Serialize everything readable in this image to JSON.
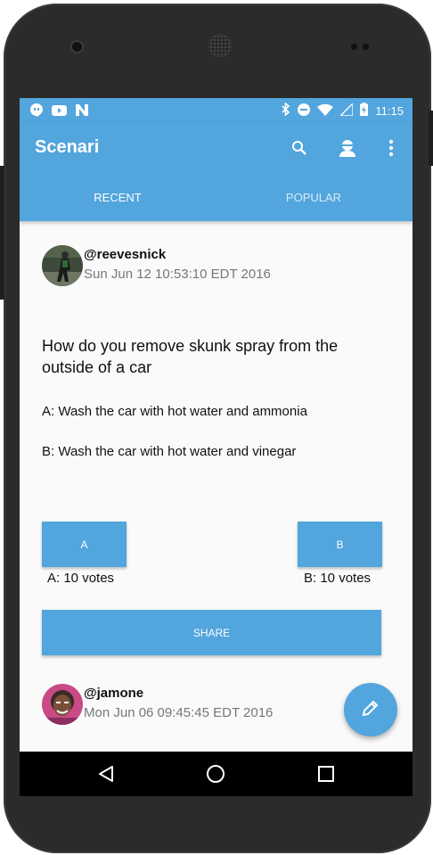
{
  "status_bar": {
    "time": "11:15",
    "left_icons": [
      "hangouts-icon",
      "youtube-icon",
      "n-notification-icon"
    ],
    "right_icons": [
      "bluetooth-icon",
      "do-not-disturb-icon",
      "wifi-icon",
      "signal-icon",
      "battery-charging-icon"
    ]
  },
  "app_bar": {
    "title": "Scenari",
    "icons": [
      "search-icon",
      "account-icon",
      "overflow-menu-icon"
    ]
  },
  "tabs": [
    {
      "label": "RECENT",
      "selected": true
    },
    {
      "label": "POPULAR",
      "selected": false
    }
  ],
  "posts": [
    {
      "username": "@reevesnick",
      "timestamp": "Sun Jun 12 10:53:10 EDT 2016",
      "question": "How do you remove skunk spray from the outside of a car",
      "option_a": "A: Wash the car with hot water and ammonia",
      "option_b": "B: Wash the car with hot water and vinegar",
      "button_a_label": "A",
      "button_b_label": "B",
      "votes_a": "A: 10 votes",
      "votes_b": "B: 10 votes",
      "share_label": "SHARE"
    },
    {
      "username": "@jamone",
      "timestamp": "Mon Jun 06 09:45:45 EDT 2016"
    }
  ],
  "fab": {
    "icon": "pencil-icon"
  },
  "nav_bar": {
    "icons": [
      "back-icon",
      "home-icon",
      "recents-icon"
    ]
  },
  "colors": {
    "primary": "#52a5dd",
    "background": "#fafafa",
    "nav": "#000000"
  }
}
